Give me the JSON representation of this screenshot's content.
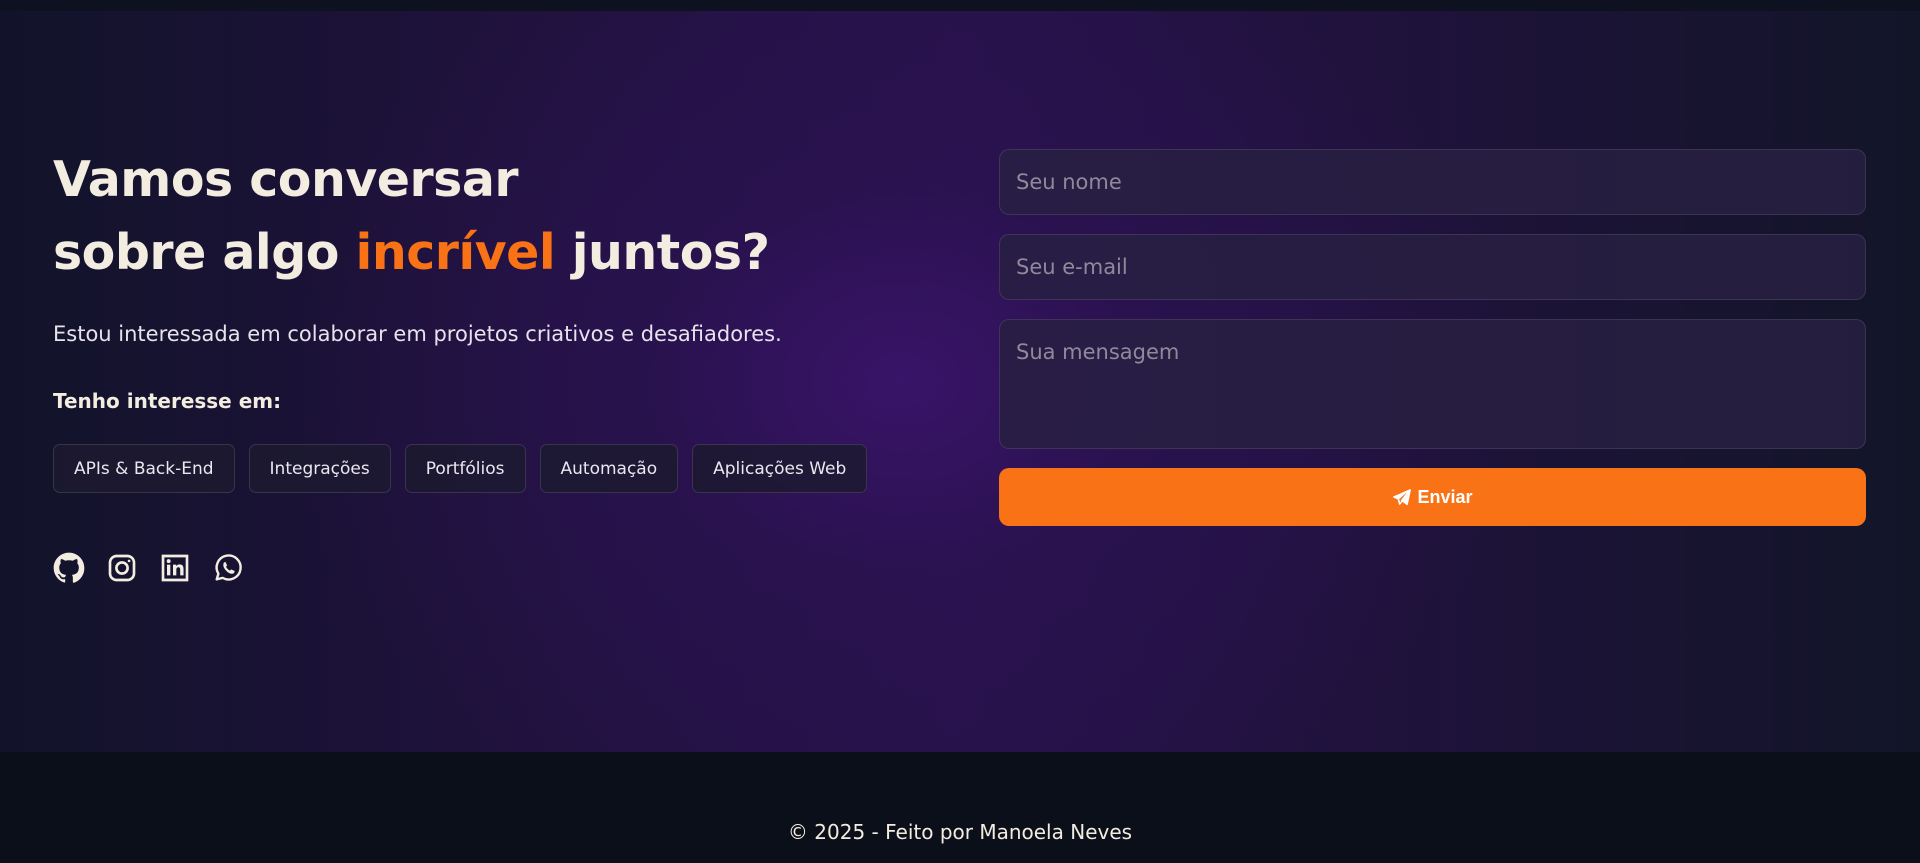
{
  "contact": {
    "headline_line1": "Vamos conversar",
    "headline_line2_before": "sobre algo ",
    "headline_accent": "incrível",
    "headline_line2_after": " juntos?",
    "lead": "Estou interessada em colaborar em projetos criativos e desafiadores.",
    "interests_title": "Tenho interesse em:",
    "interests": [
      "APIs & Back-End",
      "Integrações",
      "Portfólios",
      "Automação",
      "Aplicações Web"
    ],
    "socials": [
      {
        "icon": "github-icon"
      },
      {
        "icon": "instagram-icon"
      },
      {
        "icon": "linkedin-icon"
      },
      {
        "icon": "whatsapp-icon"
      }
    ]
  },
  "form": {
    "name_placeholder": "Seu nome",
    "email_placeholder": "Seu e-mail",
    "message_placeholder": "Sua mensagem",
    "send_label": "Enviar",
    "send_icon": "paper-plane-icon"
  },
  "footer": {
    "text": "© 2025 - Feito por Manoela Neves"
  },
  "colors": {
    "accent": "#f97316",
    "text": "#f3ece0",
    "background": "#0d111c",
    "section_glow": "#2a1250"
  }
}
